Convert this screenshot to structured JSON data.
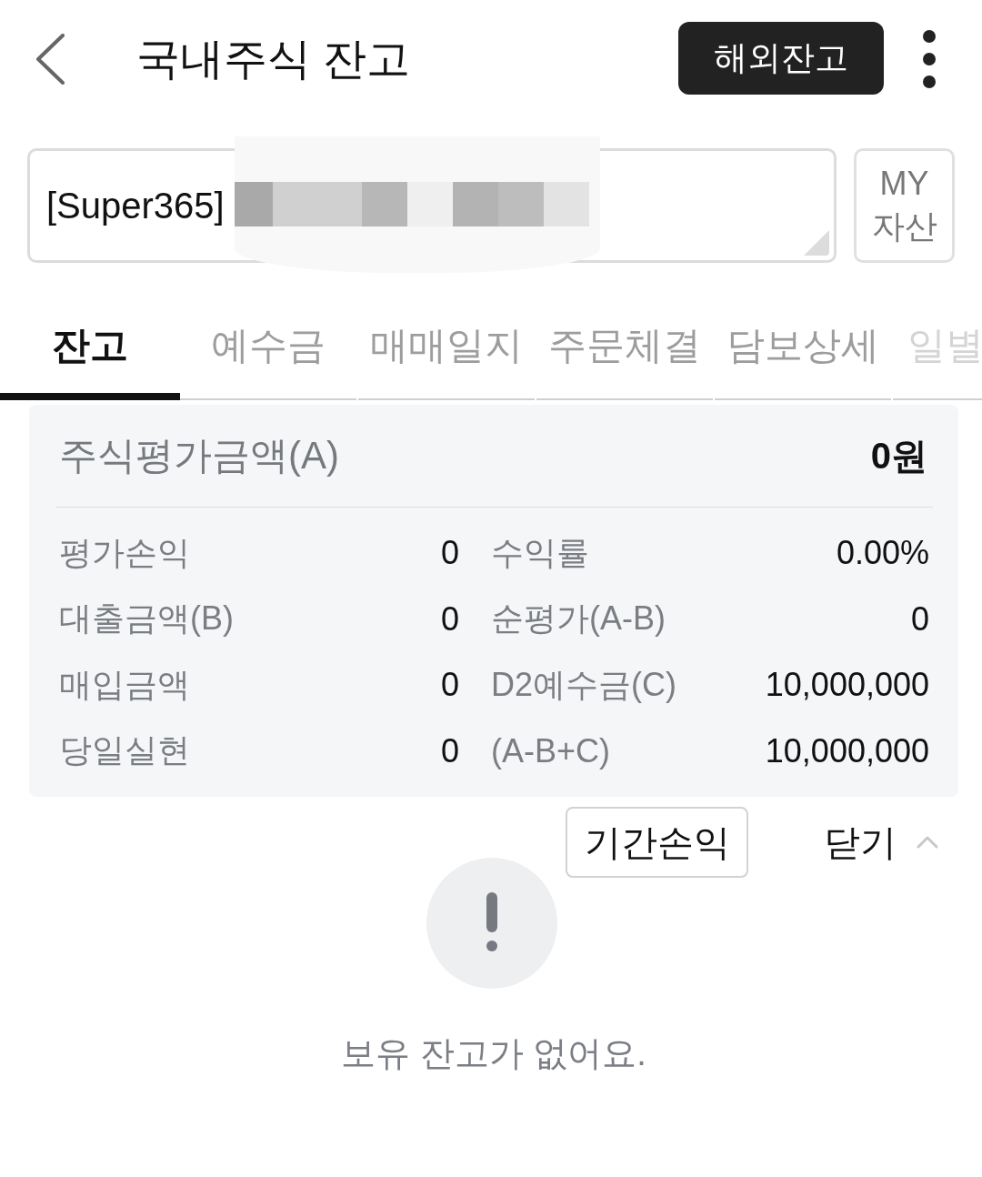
{
  "header": {
    "title": "국내주식 잔고",
    "overseas_button": "해외잔고"
  },
  "account": {
    "value": "[Super365]",
    "redacted": true,
    "my_assets_button": "MY 자산"
  },
  "tabs": [
    {
      "label": "잔고",
      "selected": true
    },
    {
      "label": "예수금",
      "selected": false
    },
    {
      "label": "매매일지",
      "selected": false
    },
    {
      "label": "주문체결",
      "selected": false
    },
    {
      "label": "담보상세",
      "selected": false
    },
    {
      "label": "일별",
      "selected": false
    }
  ],
  "summary": {
    "title": "주식평가금액(A)",
    "total": "0원",
    "rows": [
      {
        "label": "평가손익",
        "value": "0",
        "label_2": "수익률",
        "value_2": "0.00%"
      },
      {
        "label": "대출금액(B)",
        "value": "0",
        "label_2": "순평가(A-B)",
        "value_2": "0"
      },
      {
        "label": "매입금액",
        "value": "0",
        "label_2": "D2예수금(C)",
        "value_2": "10,000,000"
      },
      {
        "label": "당일실현",
        "value": "0",
        "label_2": "(A-B+C)",
        "value_2": "10,000,000"
      }
    ]
  },
  "actions": {
    "period_button": "기간손익",
    "collapse_toggle": {
      "label": "닫기",
      "expanded": true
    }
  },
  "empty_state": {
    "message": "보유 잔고가 없어요."
  }
}
